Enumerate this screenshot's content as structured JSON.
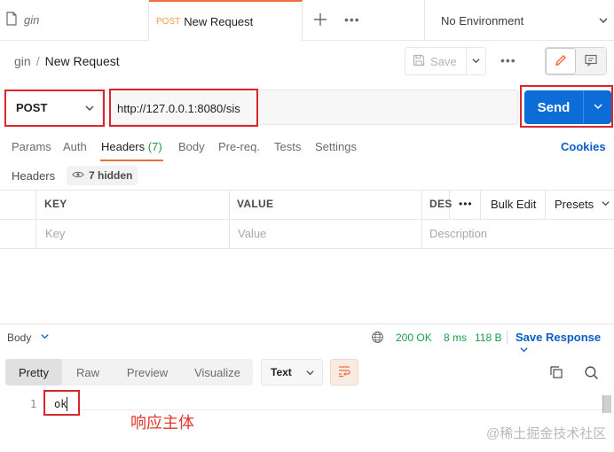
{
  "tabs": {
    "first": {
      "label": "gin"
    },
    "active": {
      "method": "POST",
      "label": "New Request"
    },
    "more": "•••"
  },
  "environment": {
    "label": "No Environment"
  },
  "header": {
    "breadcrumb_parent": "gin",
    "breadcrumb_sep": "/",
    "breadcrumb_current": "New Request",
    "save_label": "Save",
    "more": "•••"
  },
  "request": {
    "method": "POST",
    "url": "http://127.0.0.1:8080/sis",
    "send_label": "Send"
  },
  "request_tabs": [
    {
      "label": "Params"
    },
    {
      "label": "Auth"
    },
    {
      "label": "Headers",
      "count": "(7)"
    },
    {
      "label": "Body"
    },
    {
      "label": "Pre-req."
    },
    {
      "label": "Tests"
    },
    {
      "label": "Settings"
    }
  ],
  "cookies_label": "Cookies",
  "headers_section": {
    "label": "Headers",
    "hidden_label": "7 hidden"
  },
  "table": {
    "columns": {
      "key": "KEY",
      "value": "VALUE",
      "description": "DES"
    },
    "placeholders": {
      "key": "Key",
      "value": "Value",
      "description": "Description"
    },
    "more": "•••",
    "bulk_edit": "Bulk Edit",
    "presets": "Presets"
  },
  "response": {
    "body_label": "Body",
    "status": "200 OK",
    "time": "8 ms",
    "size": "118 B",
    "save_response": "Save Response",
    "view_tabs": [
      "Pretty",
      "Raw",
      "Preview",
      "Visualize"
    ],
    "active_view": "Pretty",
    "format": "Text",
    "lines": [
      {
        "num": "1",
        "text": "ok"
      }
    ]
  },
  "annotation": "响应主体",
  "watermark": "@稀土掘金技术社区",
  "colors": {
    "accent_orange": "#f26b3a",
    "send_blue": "#0d6dd8",
    "link_blue": "#0b5cc5",
    "status_green": "#1a9c4a",
    "highlight_red": "#d9262b"
  }
}
